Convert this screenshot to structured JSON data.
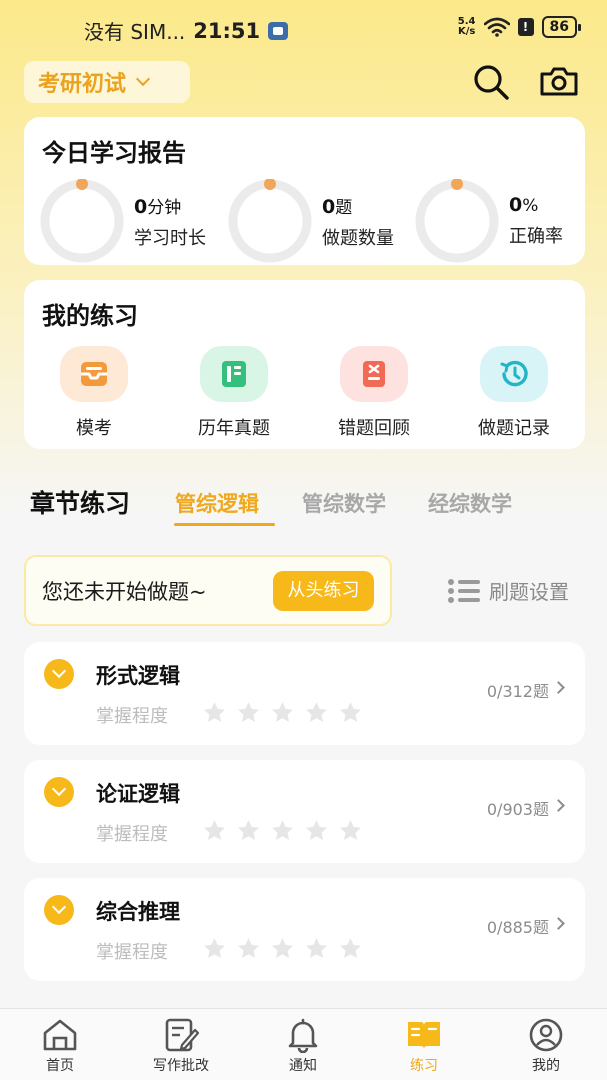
{
  "status_bar": {
    "carrier": "没有 SIM...",
    "time": "21:51",
    "net_speed_value": "5.4",
    "net_speed_unit": "K/s",
    "battery": "86"
  },
  "header": {
    "exam_type": "考研初试",
    "search_icon": "search-icon",
    "camera_icon": "camera-icon"
  },
  "report": {
    "title": "今日学习报告",
    "metrics": [
      {
        "value": "0",
        "unit": "分钟",
        "label": "学习时长",
        "progress": 0
      },
      {
        "value": "0",
        "unit": "题",
        "label": "做题数量",
        "progress": 0
      },
      {
        "value": "0",
        "unit": "%",
        "label": "正确率",
        "progress": 0
      }
    ],
    "ring_color": "#f2a65a"
  },
  "practice": {
    "title": "我的练习",
    "items": [
      {
        "label": "模考",
        "icon": "inbox-icon",
        "bg": "#fde9d6",
        "color": "#f39a3c"
      },
      {
        "label": "历年真题",
        "icon": "book-icon",
        "bg": "#d9f5e6",
        "color": "#34c07c"
      },
      {
        "label": "错题回顾",
        "icon": "error-doc-icon",
        "bg": "#fde2df",
        "color": "#f06a55"
      },
      {
        "label": "做题记录",
        "icon": "history-icon",
        "bg": "#d8f4f7",
        "color": "#23b5c6"
      }
    ]
  },
  "chapters": {
    "title": "章节练习",
    "tabs": [
      "管综逻辑",
      "管综数学",
      "经综数学"
    ],
    "active_tab": 0,
    "empty_message": "您还未开始做题~",
    "start_button": "从头练习",
    "settings_label": "刷题设置",
    "list": [
      {
        "name": "形式逻辑",
        "mastery_label": "掌握程度",
        "count": "0/312题",
        "stars": 0
      },
      {
        "name": "论证逻辑",
        "mastery_label": "掌握程度",
        "count": "0/903题",
        "stars": 0
      },
      {
        "name": "综合推理",
        "mastery_label": "掌握程度",
        "count": "0/885题",
        "stars": 0
      }
    ]
  },
  "bottom_nav": {
    "items": [
      "首页",
      "写作批改",
      "通知",
      "练习",
      "我的"
    ],
    "active": 3
  },
  "colors": {
    "accent": "#f0a81d",
    "button": "#f7b81a"
  }
}
